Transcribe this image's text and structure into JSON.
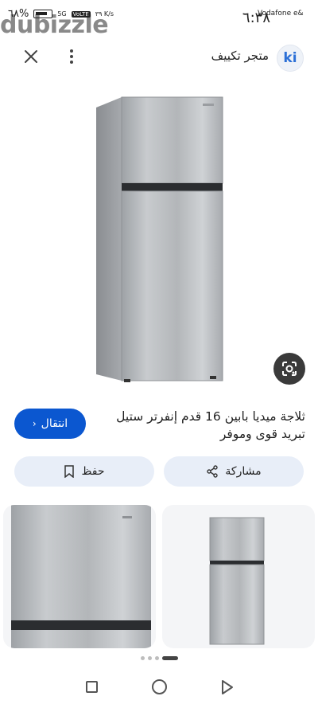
{
  "status_bar": {
    "carrier": "Vodafone e&",
    "time": "٦:٣٨",
    "battery": "٦٨%",
    "network": "5G",
    "speed": "٣٩ K/s",
    "badge": "VoLTE",
    "watermark": "dubizzle"
  },
  "header": {
    "site_name": "متجر تكييف",
    "logo_text": "ki"
  },
  "product": {
    "title": "ثلاجة ميديا بابين 16 قدم إنفرتر ستيل تبريد قوى وموفر",
    "visit_label": "انتقال"
  },
  "actions": {
    "share_label": "مشاركة",
    "save_label": "حفظ"
  },
  "colors": {
    "accent": "#0b57d0",
    "pill_bg": "#e8eef8"
  }
}
